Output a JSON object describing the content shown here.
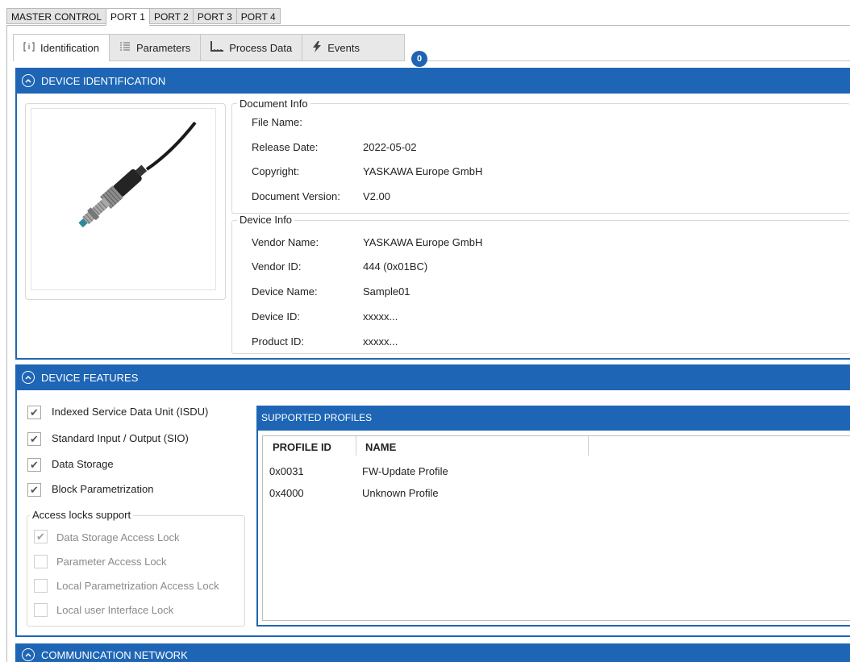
{
  "port_tabs": [
    "MASTER CONTROL",
    "PORT 1",
    "PORT 2",
    "PORT 3",
    "PORT 4"
  ],
  "active_port": "PORT 1",
  "sub_tabs": [
    {
      "label": "Identification",
      "icon": "info-icon"
    },
    {
      "label": "Parameters",
      "icon": "list-icon"
    },
    {
      "label": "Process Data",
      "icon": "chart-icon"
    },
    {
      "label": "Events",
      "icon": "lightning-icon"
    }
  ],
  "events_badge": "0",
  "device_identification": {
    "title": "DEVICE IDENTIFICATION",
    "image_alt": "sensor-image",
    "document_info": {
      "legend": "Document Info",
      "rows": [
        {
          "label": "File Name:",
          "value": ""
        },
        {
          "label": "Release Date:",
          "value": "2022-05-02"
        },
        {
          "label": "Copyright:",
          "value": "YASKAWA Europe GmbH"
        },
        {
          "label": "Document Version:",
          "value": "V2.00"
        }
      ]
    },
    "device_info": {
      "legend": "Device Info",
      "rows": [
        {
          "label": "Vendor Name:",
          "value": "YASKAWA Europe GmbH"
        },
        {
          "label": "Vendor ID:",
          "value": "444 (0x01BC)"
        },
        {
          "label": "Device Name:",
          "value": "Sample01"
        },
        {
          "label": "Device ID:",
          "value": "xxxxx..."
        },
        {
          "label": "Product ID:",
          "value": "xxxxx..."
        }
      ]
    }
  },
  "device_features": {
    "title": "DEVICE FEATURES",
    "features": [
      {
        "label": "Indexed Service Data Unit (ISDU)",
        "checked": true
      },
      {
        "label": "Standard Input / Output (SIO)",
        "checked": true
      },
      {
        "label": "Data Storage",
        "checked": true
      },
      {
        "label": "Block Parametrization",
        "checked": true
      }
    ],
    "access_locks": {
      "legend": "Access locks support",
      "items": [
        {
          "label": "Data Storage Access Lock",
          "checked": true
        },
        {
          "label": "Parameter Access Lock",
          "checked": false
        },
        {
          "label": "Local Parametrization Access Lock",
          "checked": false
        },
        {
          "label": "Local user Interface Lock",
          "checked": false
        }
      ]
    },
    "supported_profiles": {
      "title": "SUPPORTED PROFILES",
      "columns": [
        "PROFILE ID",
        "NAME"
      ],
      "rows": [
        [
          "0x0031",
          "FW-Update Profile"
        ],
        [
          "0x4000",
          "Unknown Profile"
        ]
      ]
    }
  },
  "communication_network": {
    "title": "COMMUNICATION NETWORK"
  },
  "colors": {
    "accent": "#1e66b5",
    "badge": "#1f64b3"
  }
}
